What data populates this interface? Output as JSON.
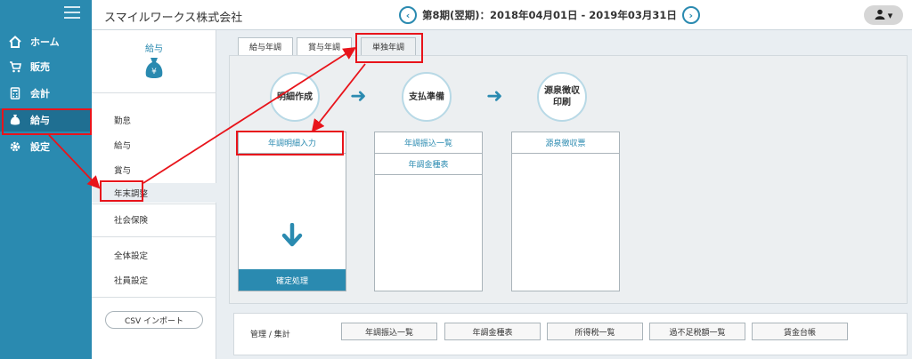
{
  "app": {
    "company": "スマイルワークス株式会社"
  },
  "period": {
    "text": "第8期(翌期)：2018年04月01日 - 2019年03月31日",
    "prev_icon": "chevron-left-icon",
    "next_icon": "chevron-right-icon"
  },
  "user": {
    "icon": "user-icon",
    "caret": "▾"
  },
  "sidebar": {
    "items": [
      {
        "label": "ホーム",
        "icon": "home-icon"
      },
      {
        "label": "販売",
        "icon": "cart-icon"
      },
      {
        "label": "会計",
        "icon": "calculator-icon"
      },
      {
        "label": "給与",
        "icon": "money-bag-icon"
      },
      {
        "label": "設定",
        "icon": "gear-icon"
      }
    ]
  },
  "subpanel": {
    "title": "給与",
    "items": [
      "勤怠",
      "給与",
      "賞与",
      "年末調整",
      "社会保険",
      "全体設定",
      "社員設定"
    ],
    "csv_button": "CSV インポート"
  },
  "tabs": [
    "給与年調",
    "賞与年調",
    "単独年調"
  ],
  "steps": [
    {
      "label": "明細作成"
    },
    {
      "label": "支払準備"
    },
    {
      "label": "源泉徴収\n印刷"
    }
  ],
  "boxes": {
    "col1": {
      "links": [
        "年調明細入力"
      ],
      "confirm": "確定処理"
    },
    "col2": {
      "links": [
        "年調振込一覧",
        "年調金種表"
      ]
    },
    "col3": {
      "links": [
        "源泉徴収票"
      ]
    }
  },
  "management": {
    "label": "管理 / 集計",
    "buttons": [
      "年調振込一覧",
      "年調金種表",
      "所得税一覧",
      "過不足税額一覧",
      "賃金台帳"
    ]
  },
  "colors": {
    "accent": "#2a8ab0",
    "annotation": "#e8141b"
  }
}
